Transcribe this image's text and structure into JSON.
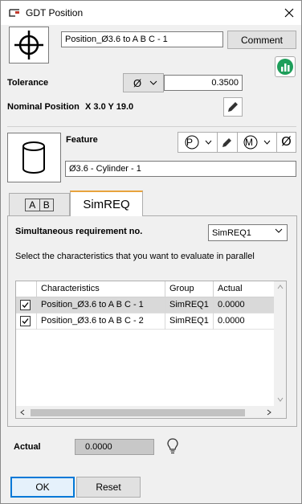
{
  "window": {
    "title": "GDT Position"
  },
  "header": {
    "name_value": "Position_Ø3.6 to A B C - 1",
    "comment_label": "Comment",
    "chart_icon": "bar-chart-icon"
  },
  "tolerance": {
    "label": "Tolerance",
    "symbol": "Ø",
    "value": "0.3500"
  },
  "nominal": {
    "label": "Nominal Position",
    "xy": "X 3.0  Y 19.0"
  },
  "feature": {
    "label": "Feature",
    "value": "Ø3.6 - Cylinder - 1",
    "modifier_p": "P",
    "modifier_m": "M",
    "diameter_symbol": "Ø"
  },
  "tabs": {
    "datum_tab": [
      "A",
      "B"
    ],
    "simreq_tab": "SimREQ"
  },
  "simreq": {
    "label": "Simultaneous requirement no.",
    "selected": "SimREQ1",
    "instruction": "Select the characteristics that you want to evaluate in parallel",
    "columns": [
      "Characteristics",
      "Group",
      "Actual"
    ],
    "rows": [
      {
        "characteristic": "Position_Ø3.6 to A B C - 1",
        "group": "SimREQ1",
        "actual": "0.0000",
        "checked": true
      },
      {
        "characteristic": "Position_Ø3.6 to A B C - 2",
        "group": "SimREQ1",
        "actual": "0.0000",
        "checked": true
      }
    ]
  },
  "result": {
    "actual_label": "Actual",
    "actual_value": "0.0000"
  },
  "footer": {
    "ok_label": "OK",
    "reset_label": "Reset"
  },
  "colors": {
    "accent_tab": "#e8a33d",
    "ok_border": "#0078d7",
    "chart_icon": "#1e9e5a"
  }
}
